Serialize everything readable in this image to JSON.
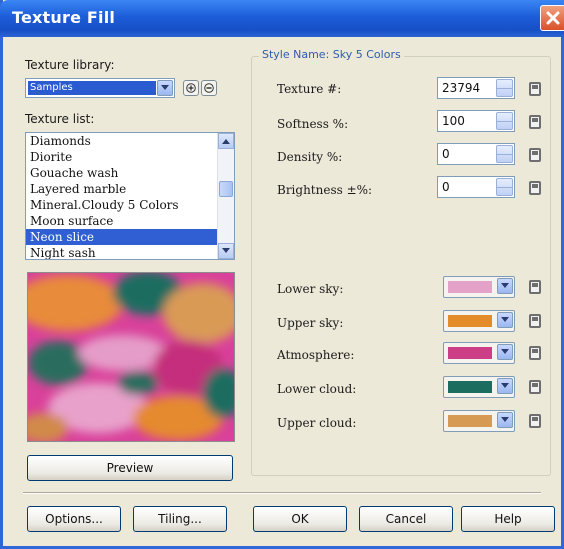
{
  "window": {
    "title": "Texture Fill"
  },
  "library": {
    "label": "Texture library:",
    "selected": "Samples"
  },
  "texture_list": {
    "label": "Texture list:",
    "items": [
      "Diamonds",
      "Diorite",
      "Gouache wash",
      "Layered marble",
      "Mineral.Cloudy 5 Colors",
      "Moon surface",
      "Neon slice",
      "Night sash"
    ],
    "selected_index": 6
  },
  "style": {
    "name_label": "Style Name: Sky 5 Colors"
  },
  "params": [
    {
      "label": "Texture #:",
      "value": "23794"
    },
    {
      "label": "Softness %:",
      "value": "100"
    },
    {
      "label": "Density %:",
      "value": "0"
    },
    {
      "label": "Brightness ±%:",
      "value": "0"
    }
  ],
  "colors": [
    {
      "label": "Lower sky:",
      "color": "#e4a2c8"
    },
    {
      "label": "Upper sky:",
      "color": "#e38c2a"
    },
    {
      "label": "Atmosphere:",
      "color": "#cc3f86"
    },
    {
      "label": "Lower cloud:",
      "color": "#1b6d5f"
    },
    {
      "label": "Upper cloud:",
      "color": "#d79a55"
    }
  ],
  "buttons": {
    "preview": "Preview",
    "options": "Options...",
    "tiling": "Tiling...",
    "ok": "OK",
    "cancel": "Cancel",
    "help": "Help"
  },
  "theme": {
    "title_bar": "#1f5fd8",
    "selection": "#2f5fd2",
    "group_title": "#2f5bb0"
  }
}
